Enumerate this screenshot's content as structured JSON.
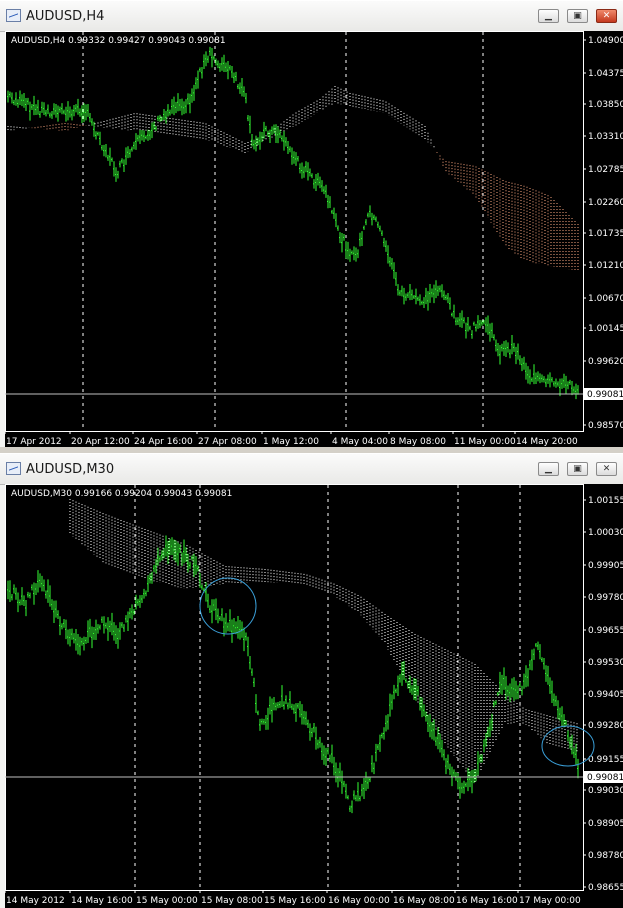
{
  "windows": [
    {
      "title": "AUDUSD,H4",
      "info": "AUDUSD,H4  0.99332 0.99427 0.99043 0.99081",
      "current_price": "0.99081",
      "price_ticks": [
        "1.04900",
        "1.04375",
        "1.03850",
        "1.03310",
        "1.02785",
        "1.02260",
        "1.01735",
        "1.01210",
        "1.00670",
        "1.00145",
        "0.99620",
        "0.99081",
        "0.98570"
      ],
      "time_ticks": [
        "17 Apr 2012",
        "20 Apr 12:00",
        "24 Apr 16:00",
        "27 Apr 08:00",
        "1 May 12:00",
        "4 May 04:00",
        "8 May 08:00",
        "11 May 00:00",
        "14 May 20:00"
      ]
    },
    {
      "title": "AUDUSD,M30",
      "info": "AUDUSD,M30  0.99166 0.99204 0.99043 0.99081",
      "current_price": "0.99081",
      "price_ticks": [
        "1.00155",
        "1.00030",
        "0.99905",
        "0.99780",
        "0.99655",
        "0.99530",
        "0.99405",
        "0.99280",
        "0.99155",
        "0.99081",
        "0.99030",
        "0.98905",
        "0.98780",
        "0.98655"
      ],
      "time_ticks": [
        "14 May 2012",
        "14 May 16:00",
        "15 May 00:00",
        "15 May 08:00",
        "15 May 16:00",
        "16 May 00:00",
        "16 May 08:00",
        "16 May 16:00",
        "17 May 00:00"
      ]
    }
  ],
  "colors": {
    "bars": "#33ff33",
    "cloud_a": "#f5a27c",
    "cloud_b": "#ffffff",
    "grid": "#ffffff",
    "bg": "#000000",
    "marker": "#3a9fd8"
  },
  "icons": [
    "chart-window-icon",
    "minimize-icon",
    "maximize-icon",
    "close-icon"
  ]
}
